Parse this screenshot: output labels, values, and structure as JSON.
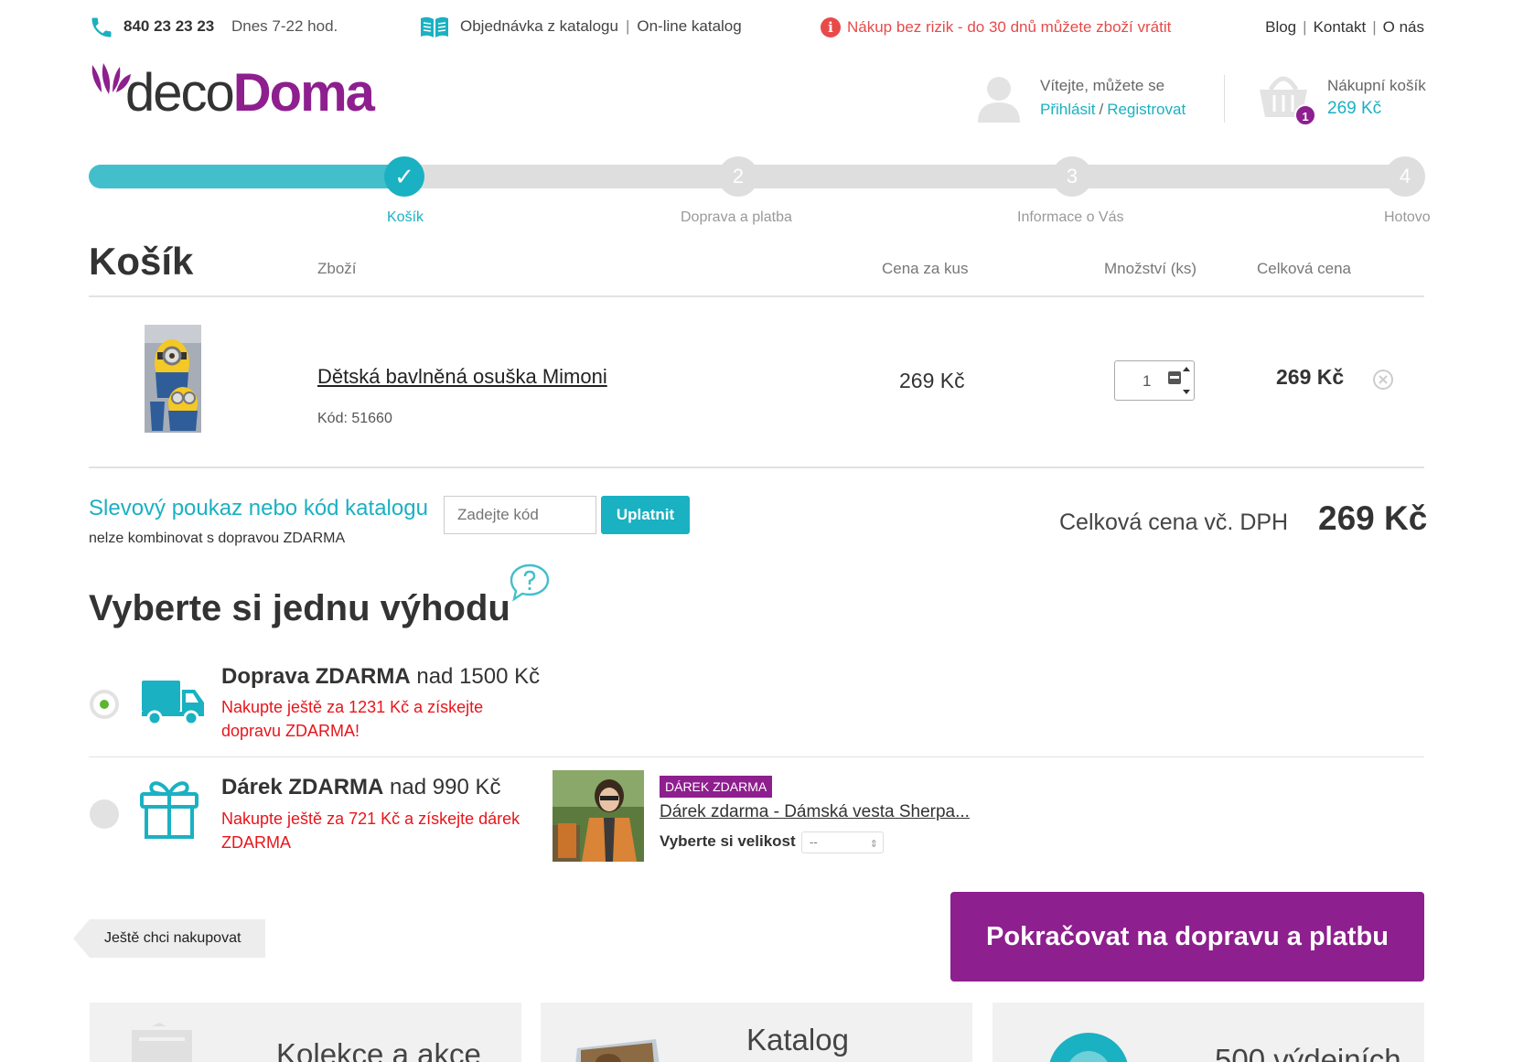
{
  "topbar": {
    "phone": "840 23 23 23",
    "hours": "Dnes 7-22 hod.",
    "catalog_order": "Objednávka z katalogu",
    "online_catalog": "On-line katalog",
    "risk_icon": "i",
    "risk_text": "Nákup bez rizik - do 30 dnů můžete zboží vrátit",
    "links": [
      "Blog",
      "Kontakt",
      "O nás"
    ]
  },
  "header": {
    "logo_part1": "deco",
    "logo_part2": "Doma",
    "welcome": "Vítejte, můžete se",
    "login": "Přihlásit",
    "register": "Registrovat",
    "basket_label": "Nákupní košík",
    "basket_price": "269 Kč",
    "basket_count": "1"
  },
  "steps": [
    {
      "num": "✓",
      "label": "Košík",
      "active": true
    },
    {
      "num": "2",
      "label": "Doprava a platba",
      "active": false
    },
    {
      "num": "3",
      "label": "Informace o Vás",
      "active": false
    },
    {
      "num": "4",
      "label": "Hotovo",
      "active": false
    }
  ],
  "cart": {
    "title": "Košík",
    "columns": [
      "Zboží",
      "Cena za kus",
      "Množství (ks)",
      "Celková cena"
    ],
    "items": [
      {
        "name": "Dětská bavlněná osuška Mimoni",
        "code": "Kód: 51660",
        "unit_price": "269 Kč",
        "qty": "1",
        "total": "269 Kč"
      }
    ]
  },
  "coupon": {
    "title": "Slevový poukaz nebo kód katalogu",
    "note": "nelze kombinovat s dopravou ZDARMA",
    "placeholder": "Zadejte kód",
    "button": "Uplatnit"
  },
  "total": {
    "label": "Celková cena vč. DPH",
    "value": "269 Kč"
  },
  "benefits": {
    "title": "Vyberte si jednu výhodu",
    "items": [
      {
        "bold": "Doprava ZDARMA",
        "rest": " nad 1500 Kč",
        "note": "Nakupte ještě za 1231 Kč a získejte dopravu ZDARMA!",
        "selected": true
      },
      {
        "bold": "Dárek ZDARMA",
        "rest": " nad 990 Kč",
        "note": "Nakupte ještě za 721 Kč a získejte dárek ZDARMA",
        "selected": false
      }
    ],
    "gift": {
      "badge": "DÁREK ZDARMA",
      "link": "Dárek zdarma - Dámská vesta Sherpa...",
      "size_label": "Vyberte si velikost",
      "size_value": "--"
    }
  },
  "actions": {
    "back": "Ještě chci nakupovat",
    "continue": "Pokračovat na dopravu a platbu"
  },
  "promos": [
    {
      "text": "Kolekce a akce"
    },
    {
      "text": "Katalog"
    },
    {
      "text": "500 výdejních"
    }
  ],
  "colors": {
    "accent": "#1ab1c2",
    "brand": "#8e1f8e",
    "alert": "#e8151b",
    "ok": "#5cb531"
  }
}
